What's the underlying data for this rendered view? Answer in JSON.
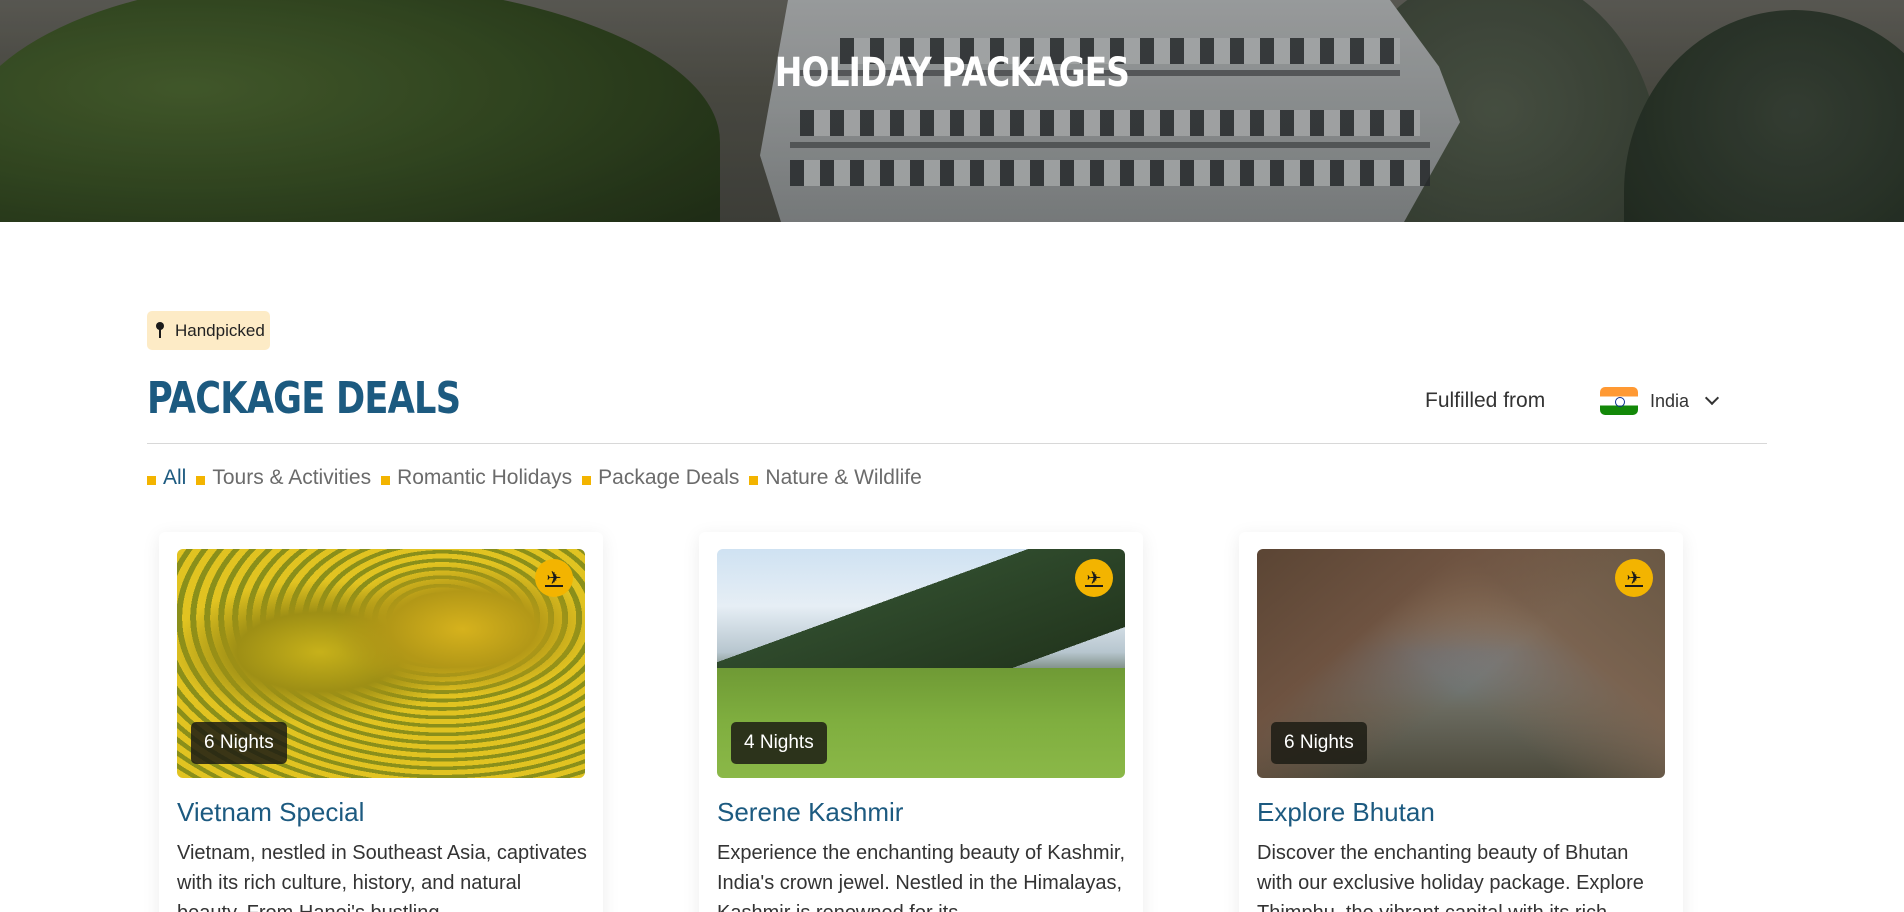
{
  "hero": {
    "title": "HOLIDAY PACKAGES"
  },
  "section": {
    "tag": {
      "icon": "pin-icon",
      "label": "Handpicked"
    },
    "title": "PACKAGE DEALS",
    "fulfilled_label": "Fulfilled from",
    "country": {
      "icon": "india-flag-icon",
      "value": "India"
    }
  },
  "filters": [
    {
      "label": "All",
      "active": true
    },
    {
      "label": "Tours & Activities",
      "active": false
    },
    {
      "label": "Romantic Holidays",
      "active": false
    },
    {
      "label": "Package Deals",
      "active": false
    },
    {
      "label": "Nature & Wildlife",
      "active": false
    }
  ],
  "cards": [
    {
      "nights": "6 Nights",
      "title": "Vietnam Special",
      "description": "Vietnam, nestled in Southeast Asia, captivates with its rich culture, history, and natural beauty. From Hanoi's bustling",
      "icon": "flight-icon"
    },
    {
      "nights": "4 Nights",
      "title": "Serene Kashmir",
      "description": "Experience the enchanting beauty of Kashmir, India's crown jewel. Nestled in the Himalayas, Kashmir is renowned for its",
      "icon": "flight-icon"
    },
    {
      "nights": "6 Nights",
      "title": "Explore Bhutan",
      "description": "Discover the enchanting beauty of Bhutan with our exclusive holiday package. Explore Thimphu, the vibrant capital with its rich",
      "icon": "flight-icon"
    }
  ],
  "colors": {
    "accent": "#f3b400",
    "brand": "#1c5a80",
    "tag_bg": "#fdebc6"
  }
}
